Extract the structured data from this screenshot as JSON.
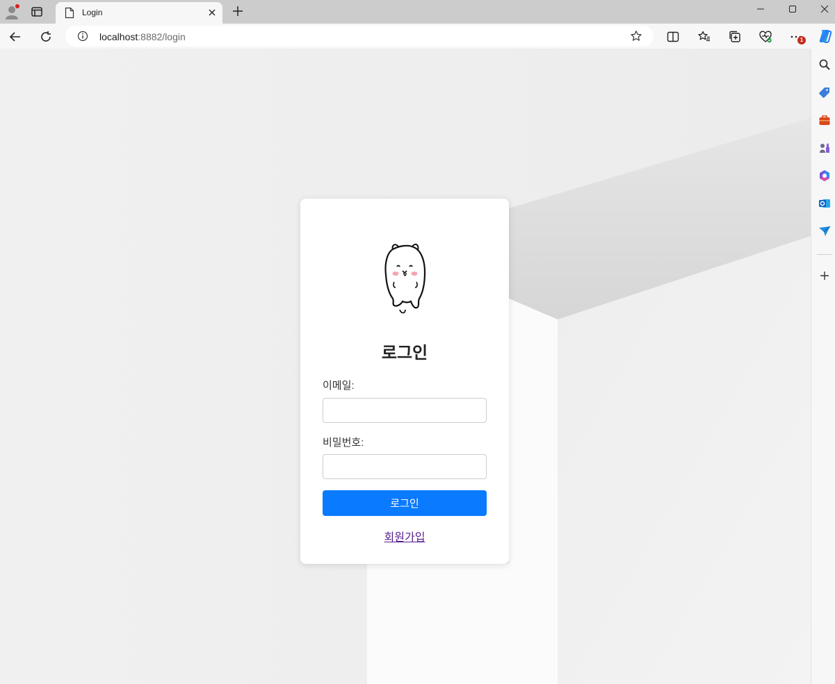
{
  "browser": {
    "tab_title": "Login",
    "url_host": "localhost",
    "url_rest": ":8882/login",
    "notification_count": "1"
  },
  "login": {
    "title": "로그인",
    "email_label": "이메일:",
    "email_value": "",
    "password_label": "비밀번호:",
    "password_value": "",
    "submit_label": "로그인",
    "signup_label": "회원가입"
  },
  "colors": {
    "primary_button": "#0a7aff",
    "visited_link": "#551a8b"
  }
}
